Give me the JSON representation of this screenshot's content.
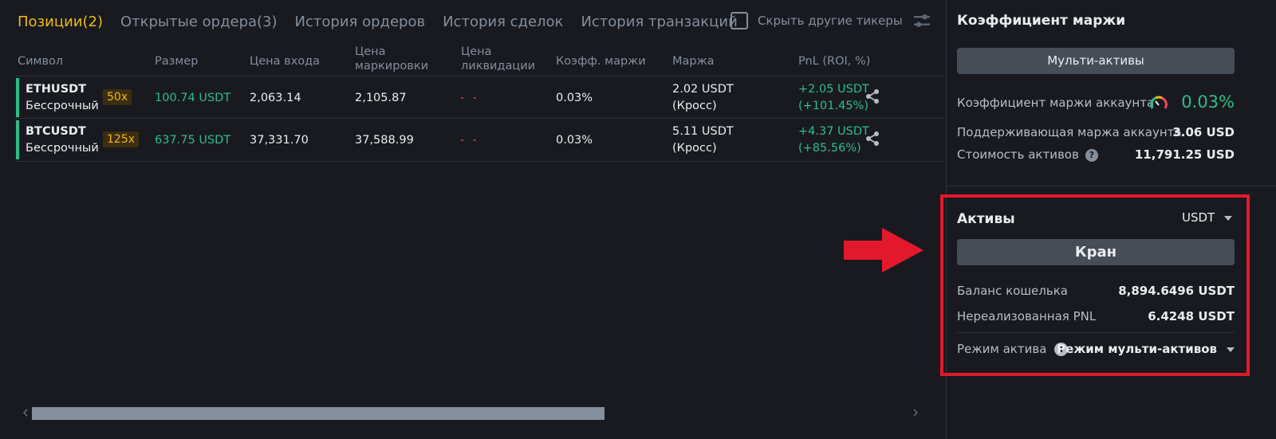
{
  "tabs": [
    {
      "label": "Позиции(2)",
      "active": true
    },
    {
      "label": "Открытые ордера(3)"
    },
    {
      "label": "История ордеров"
    },
    {
      "label": "История сделок"
    },
    {
      "label": "История транзакций"
    }
  ],
  "hide_other_tickers": {
    "label": "Скрыть другие тикеры",
    "checked": false
  },
  "columns": {
    "symbol": "Символ",
    "size": "Размер",
    "entry": "Цена входа",
    "mark_1": "Цена",
    "mark_2": "маркировки",
    "liq_1": "Цена",
    "liq_2": "ликвидации",
    "margin_ratio": "Коэфф. маржи",
    "margin": "Маржа",
    "pnl": "PnL (ROI, %)"
  },
  "positions": [
    {
      "symbol": "ETHUSDT",
      "type": "Бессрочный",
      "leverage": "50x",
      "size": "100.74 USDT",
      "entry": "2,063.14",
      "mark": "2,105.87",
      "liq": "- -",
      "ratio": "0.03%",
      "margin": "2.02 USDT",
      "margin_mode": "(Кросс)",
      "pnl": "+2.05 USDT",
      "roi": "(+101.45%)"
    },
    {
      "symbol": "BTCUSDT",
      "type": "Бессрочный",
      "leverage": "125x",
      "size": "637.75 USDT",
      "entry": "37,331.70",
      "mark": "37,588.99",
      "liq": "- -",
      "ratio": "0.03%",
      "margin": "5.11 USDT",
      "margin_mode": "(Кросс)",
      "pnl": "+4.37 USDT",
      "roi": "(+85.56%)"
    }
  ],
  "margin_panel": {
    "title": "Коэффициент маржи",
    "multi_assets_button": "Мульти-активы",
    "account_ratio_label": "Коэффициент маржи аккаунта",
    "account_ratio_value": "0.03%",
    "maintenance_label": "Поддерживающая маржа аккаунта",
    "maintenance_value": "3.06 USD",
    "asset_value_label": "Стоимость активов",
    "asset_value": "11,791.25 USD"
  },
  "assets_panel": {
    "title": "Активы",
    "currency": "USDT",
    "faucet_button": "Кран",
    "wallet_label": "Баланс кошелька",
    "wallet_value": "8,894.6496 USDT",
    "unrealized_label": "Нереализованная PNL",
    "unrealized_value": "6.4248 USDT",
    "mode_label": "Режим актива",
    "mode_value": "Режим мульти-активов"
  },
  "colors": {
    "accent": "#f0b90b",
    "positive": "#2ebd85",
    "highlight": "#e3192b",
    "background": "#181a20"
  }
}
